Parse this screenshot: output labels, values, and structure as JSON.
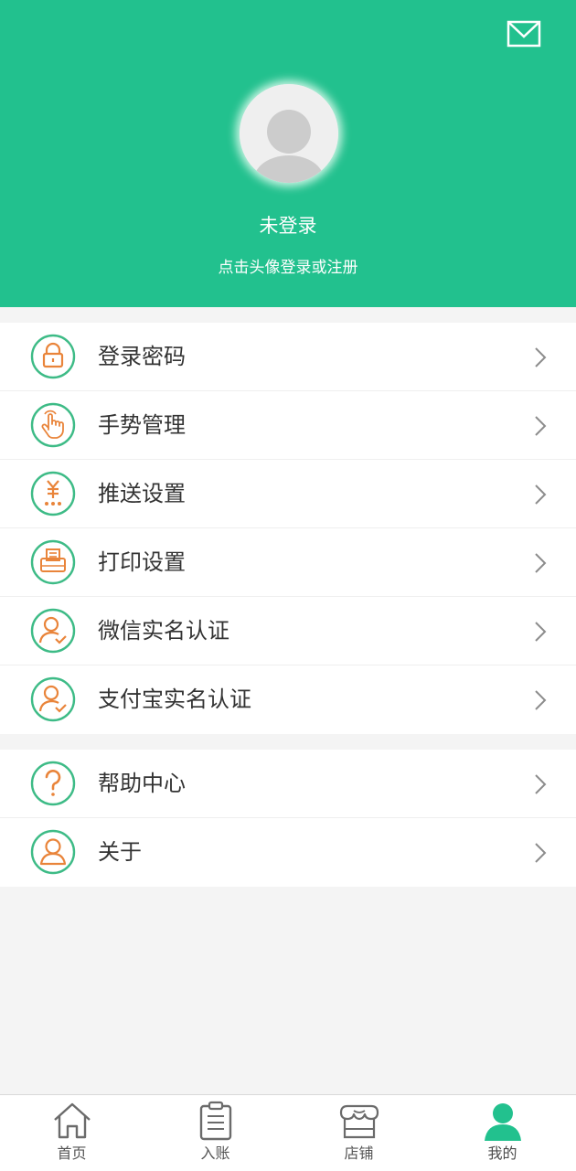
{
  "header": {
    "title": "未登录",
    "subtitle": "点击头像登录或注册",
    "background_color": "#22c18e",
    "mail_icon": "mail-icon",
    "avatar_icon": "default-avatar-icon"
  },
  "menu_group_1": [
    {
      "label": "登录密码",
      "icon": "lock-icon"
    },
    {
      "label": "手势管理",
      "icon": "gesture-hand-icon"
    },
    {
      "label": "推送设置",
      "icon": "yuan-push-icon"
    },
    {
      "label": "打印设置",
      "icon": "printer-icon"
    },
    {
      "label": "微信实名认证",
      "icon": "user-verified-icon"
    },
    {
      "label": "支付宝实名认证",
      "icon": "user-verified-icon"
    }
  ],
  "menu_group_2": [
    {
      "label": "帮助中心",
      "icon": "question-icon"
    },
    {
      "label": "关于",
      "icon": "user-icon"
    }
  ],
  "tabbar": [
    {
      "label": "首页",
      "icon": "home-icon",
      "active": false
    },
    {
      "label": "入账",
      "icon": "clipboard-icon",
      "active": false
    },
    {
      "label": "店铺",
      "icon": "store-icon",
      "active": false
    },
    {
      "label": "我的",
      "icon": "person-icon",
      "active": true
    }
  ],
  "colors": {
    "accent_green": "#22c18e",
    "icon_ring_green": "#3dbb86",
    "icon_orange": "#e9843a"
  }
}
